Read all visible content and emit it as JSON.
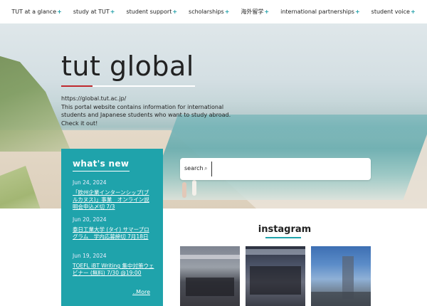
{
  "nav": {
    "items": [
      {
        "label": "TUT at a glance"
      },
      {
        "label": "study at TUT"
      },
      {
        "label": "student support"
      },
      {
        "label": "scholarships"
      },
      {
        "label": "海外留学"
      },
      {
        "label": "international partnerships"
      },
      {
        "label": "student voice"
      }
    ],
    "plus": "+"
  },
  "hero": {
    "title": "tut global",
    "url": "https://global.tut.ac.jp/",
    "description": "This portal website contains information for international students and Japanese students who want to study abroad. Check it out!"
  },
  "search": {
    "label": "search",
    "icon": "⌕",
    "placeholder": ""
  },
  "whats_new": {
    "title": "what's new",
    "items": [
      {
        "date": "Jun 24, 2024",
        "text": "「欧州企業インターンシップ(ブルカヌス)」事業　オンライン説明会申込〆切 7/3"
      },
      {
        "date": "Jun 20, 2024",
        "text": "泰日工業大学 (タイ) サマープログラム　学内応募締切 7月18日"
      },
      {
        "date": "Jun 19, 2024",
        "text": "TOEFL iBT Writing 集中対策ウェビナー (無料) 7/30 @19:00"
      }
    ],
    "more": "..More"
  },
  "instagram": {
    "title": "instagram"
  },
  "colors": {
    "accent": "#1fa3ab",
    "title_underline": "#c0282d"
  }
}
